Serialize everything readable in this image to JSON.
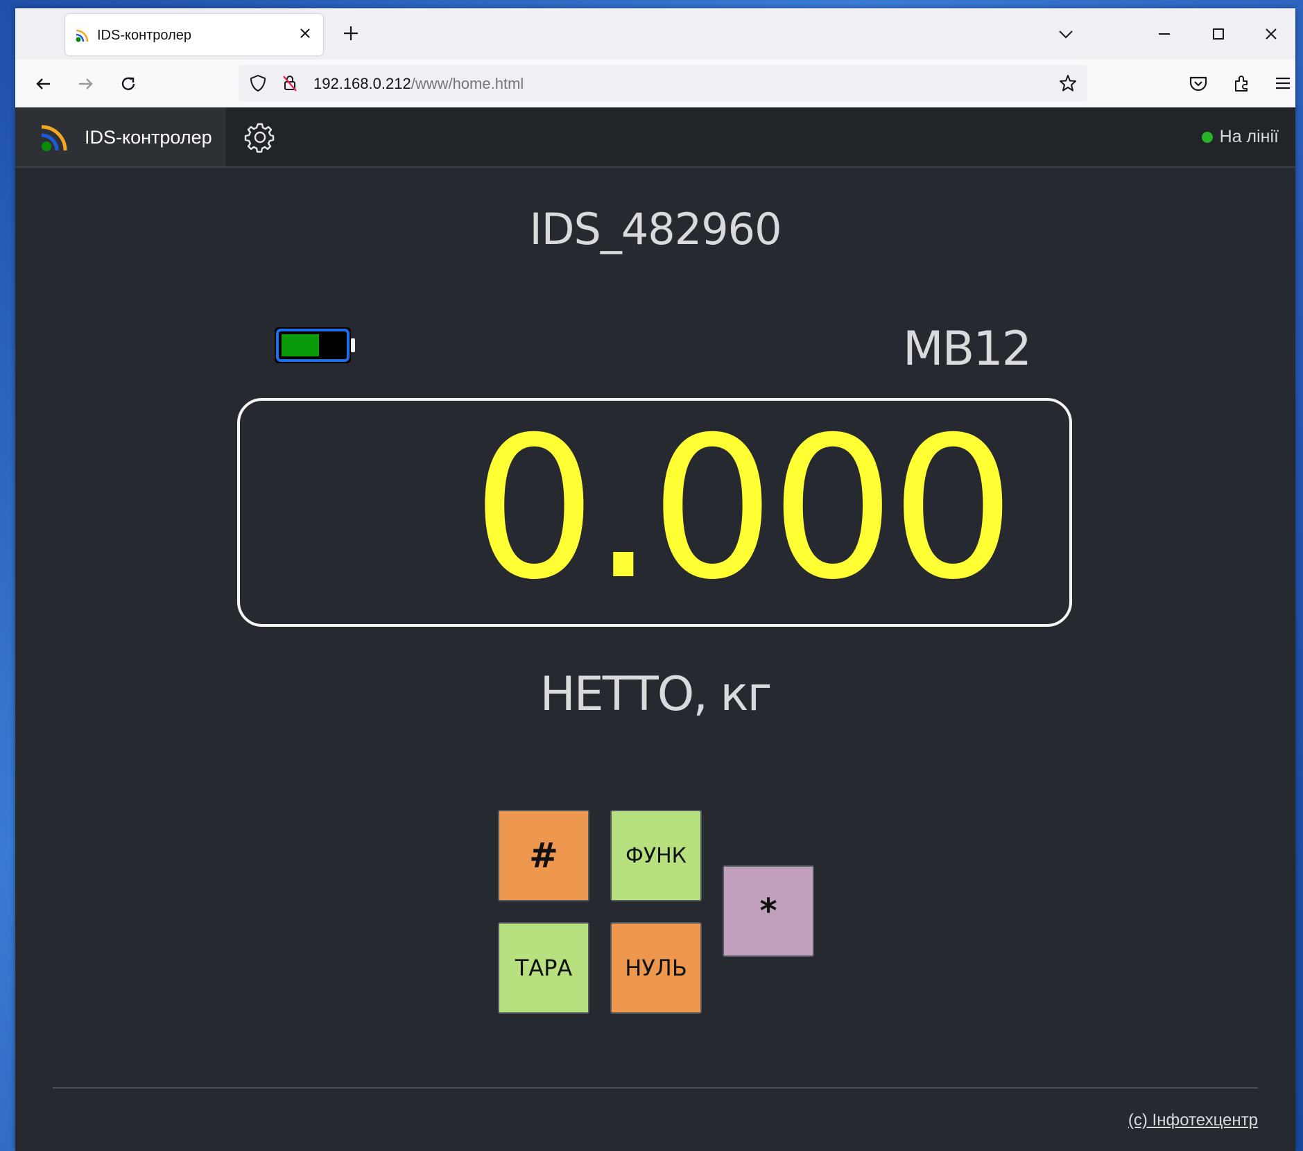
{
  "browser": {
    "tab_title": "IDS-контролер",
    "url_host": "192.168.0.212",
    "url_path": "/www/home.html"
  },
  "header": {
    "brand_title": "IDS-контролер",
    "status_label": "На лінії",
    "status_color": "#28b428"
  },
  "main": {
    "device_name": "IDS_482960",
    "scale_id": "MB12",
    "weight": "0.000",
    "unit_label": "НЕТТО, кг",
    "battery_level": 0.6,
    "battery_color": "#0a9a0a",
    "display_color": "#ffff33"
  },
  "keys": {
    "hash": {
      "label": "#",
      "color": "#ee984f"
    },
    "func": {
      "label": "ФУНК",
      "color": "#b7e07e"
    },
    "tare": {
      "label": "ТАРА",
      "color": "#b7e07e"
    },
    "zero": {
      "label": "НУЛЬ",
      "color": "#ee984f"
    },
    "star": {
      "label": "*",
      "color": "#c1a0bd"
    }
  },
  "footer": {
    "copyright": "(c) Інфотехцентр"
  }
}
